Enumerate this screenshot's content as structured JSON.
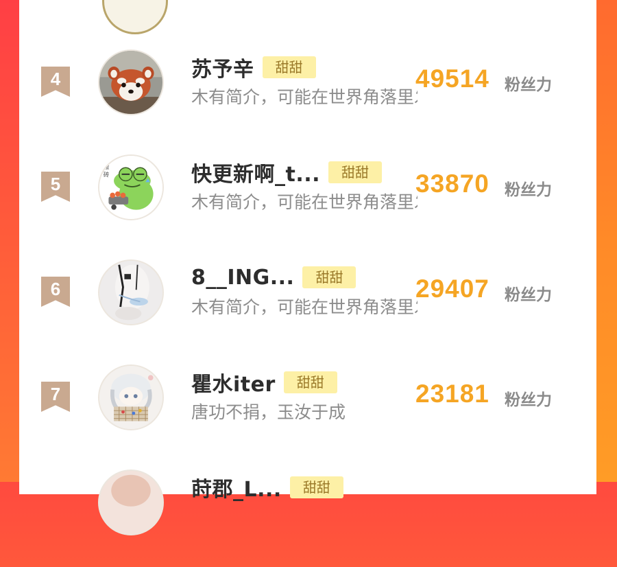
{
  "unit_label": "粉丝力",
  "ranking": [
    {
      "rank": "4",
      "name": "苏予辛",
      "tag": "甜甜",
      "bio": "木有简介，可能在世界角落里发呆",
      "score": "49514",
      "avatar": "red-panda-avatar"
    },
    {
      "rank": "5",
      "name": "快更新啊_t...",
      "tag": "甜甜",
      "bio": "木有简介，可能在世界角落里发呆",
      "score": "33870",
      "avatar": "frog-cartoon-avatar"
    },
    {
      "rank": "6",
      "name": "8__ING...",
      "tag": "甜甜",
      "bio": "木有简介，可能在世界角落里发呆",
      "score": "29407",
      "avatar": "doll-photo-avatar"
    },
    {
      "rank": "7",
      "name": "瞿水iter",
      "tag": "甜甜",
      "bio": "唐功不捐，玉汝于成",
      "score": "23181",
      "avatar": "anime-girl-avatar"
    }
  ],
  "next_partial": {
    "name": "莳郡_L...",
    "tag": "甜甜"
  },
  "colors": {
    "score": "#f5a524",
    "tag_bg": "#fdf0a6",
    "rank_flag": "#c9a990",
    "background_gradient_top": "#ff4a3f",
    "background_gradient_bottom": "#ff9c26"
  }
}
